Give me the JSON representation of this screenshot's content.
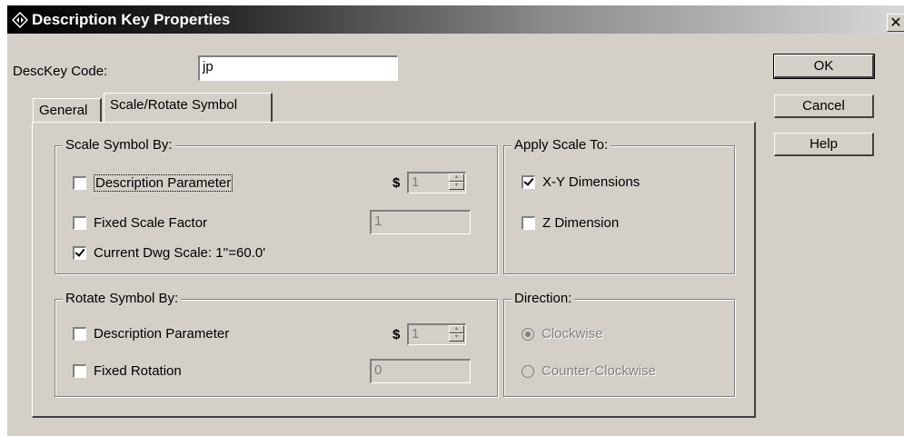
{
  "window": {
    "title": "Description Key Properties",
    "close_glyph": "✕",
    "icon": "dialog-app-icon"
  },
  "desckey": {
    "label": "DescKey Code:",
    "value": "jp"
  },
  "buttons": {
    "ok": "OK",
    "cancel": "Cancel",
    "help": "Help"
  },
  "tabs": [
    {
      "label": "General",
      "active": false
    },
    {
      "label": "Scale/Rotate Symbol",
      "active": true
    }
  ],
  "scale_group": {
    "title": "Scale Symbol By:",
    "description_parameter": {
      "label": "Description Parameter",
      "checked": false
    },
    "currency": "$",
    "param_value": "1",
    "fixed_scale": {
      "label": "Fixed Scale Factor",
      "checked": false,
      "value": "1"
    },
    "current_dwg": {
      "label": "Current Dwg Scale: 1''=60.0'",
      "checked": true
    }
  },
  "apply_group": {
    "title": "Apply Scale To:",
    "xy": {
      "label": "X-Y Dimensions",
      "checked": true
    },
    "z": {
      "label": "Z Dimension",
      "checked": false
    }
  },
  "rotate_group": {
    "title": "Rotate Symbol By:",
    "description_parameter": {
      "label": "Description Parameter",
      "checked": false
    },
    "currency": "$",
    "param_value": "1",
    "fixed_rotation": {
      "label": "Fixed Rotation",
      "checked": false,
      "value": "0"
    }
  },
  "direction_group": {
    "title": "Direction:",
    "clockwise": {
      "label": "Clockwise",
      "selected": true
    },
    "counter_clockwise": {
      "label": "Counter-Clockwise",
      "selected": false
    }
  },
  "colors": {
    "face": "#d4d0c8",
    "disabled_text": "#808080",
    "title_start": "#000000",
    "title_end": "#d8d8d8"
  }
}
